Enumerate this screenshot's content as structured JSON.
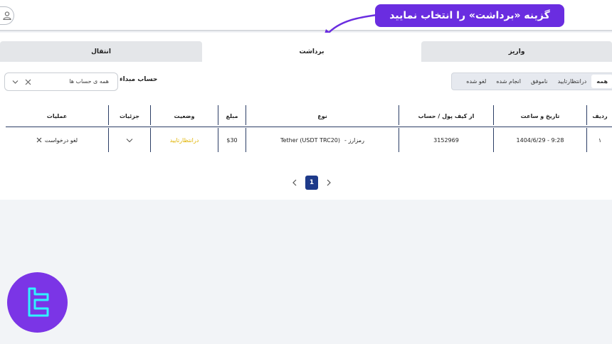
{
  "callout": {
    "text": "گزینه «برداشت» را انتخاب نمایید"
  },
  "tabs": [
    {
      "label": "واریز",
      "active": false
    },
    {
      "label": "برداشت",
      "active": true
    },
    {
      "label": "انتقال",
      "active": false
    }
  ],
  "filters": {
    "options": [
      {
        "label": "همه",
        "active": true
      },
      {
        "label": "درانتظارتایید",
        "active": false
      },
      {
        "label": "ناموفق",
        "active": false
      },
      {
        "label": "انجام شده",
        "active": false
      },
      {
        "label": "لغو شده",
        "active": false
      }
    ]
  },
  "source_account": {
    "label": "حساب مبداء",
    "value": "همه ی حساب ها"
  },
  "table": {
    "headers": {
      "row": "ردیف",
      "datetime": "تاریخ و ساعت",
      "wallet": "از کیف پول / حساب",
      "type": "نوع",
      "amount": "مبلغ",
      "status": "وضعیت",
      "details": "جزئیات",
      "actions": "عملیات"
    },
    "rows": [
      {
        "row": "۱",
        "datetime": "1404/6/29 - 9:28",
        "wallet": "3152969",
        "type_name": "Tether (USDT TRC20)",
        "type_kind": "رمزارز  -",
        "amount": "$30",
        "status": "درانتظارتایید",
        "action": "لغو درخواست"
      }
    ]
  },
  "pagination": {
    "current": "1"
  },
  "colors": {
    "accent": "#6a2de0",
    "primary": "#1e3a8a",
    "pending": "#e0b300"
  }
}
